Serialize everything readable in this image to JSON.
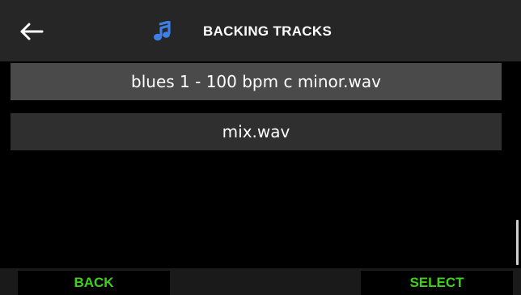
{
  "header": {
    "title": "BACKING TRACKS",
    "back_icon": "arrow-left-icon",
    "music_icon": "music-note-icon",
    "accent_color": "#3d7fe6"
  },
  "tracks": [
    {
      "label": "blues 1 - 100 bpm c minor.wav",
      "selected": true
    },
    {
      "label": "mix.wav",
      "selected": false
    }
  ],
  "footer": {
    "back_label": "BACK",
    "select_label": "SELECT",
    "button_color": "#3ed11a"
  }
}
